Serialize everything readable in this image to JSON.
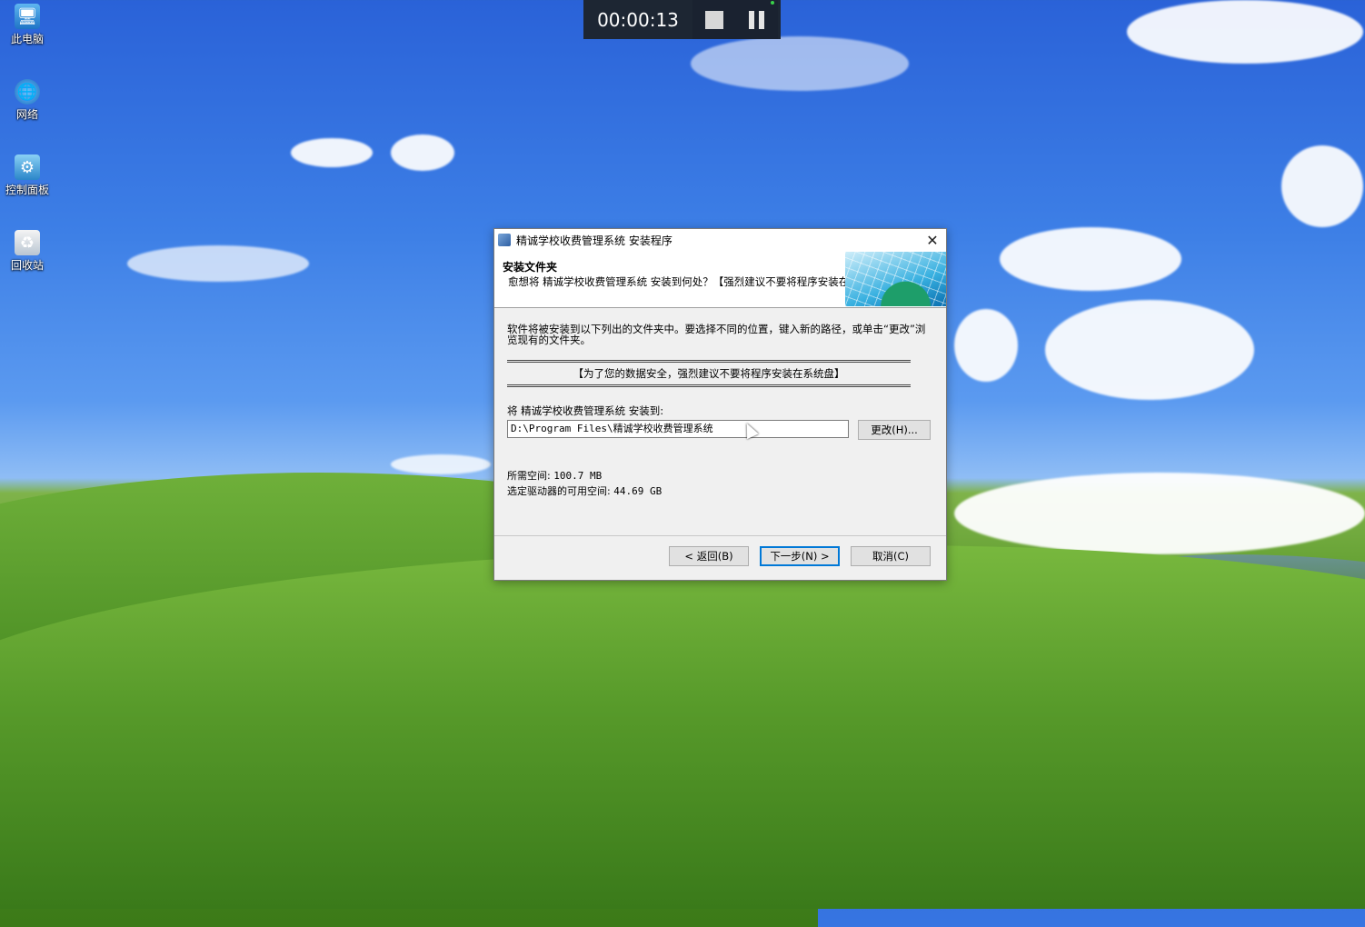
{
  "desktop": {
    "icons": [
      {
        "label": "此电脑",
        "icon": "computer-icon"
      },
      {
        "label": "网络",
        "icon": "network-icon"
      },
      {
        "label": "控制面板",
        "icon": "control-panel-icon"
      },
      {
        "label": "回收站",
        "icon": "recycle-bin-icon"
      }
    ]
  },
  "recorder": {
    "time": "00:00:13",
    "status_color": "#3ad14a"
  },
  "dialog": {
    "title": "精诚学校收费管理系统 安装程序",
    "header_title": "安装文件夹",
    "header_subtitle": "愈想将 精诚学校收费管理系统 安装到何处？【强烈建议不要将程序安装在系统盘】",
    "description": "软件将被安装到以下列出的文件夹中。要选择不同的位置，键入新的路径，或单击“更改”浏览现有的文件夹。",
    "warning": "【为了您的数据安全，强烈建议不要将程序安装在系统盘】",
    "install_to_label": "将 精诚学校收费管理系统 安装到:",
    "install_path": "D:\\Program Files\\精诚学校收费管理系统",
    "change_button": "更改(H)...",
    "required_space_label": "所需空间:",
    "required_space_value": "100.7 MB",
    "available_space_label": "选定驱动器的可用空间:",
    "available_space_value": "44.69 GB",
    "back_button": "< 返回(B)",
    "next_button": "下一步(N) >",
    "cancel_button": "取消(C)"
  },
  "colors": {
    "accent": "#0078d7",
    "dialog_bg": "#f0f0f0"
  }
}
